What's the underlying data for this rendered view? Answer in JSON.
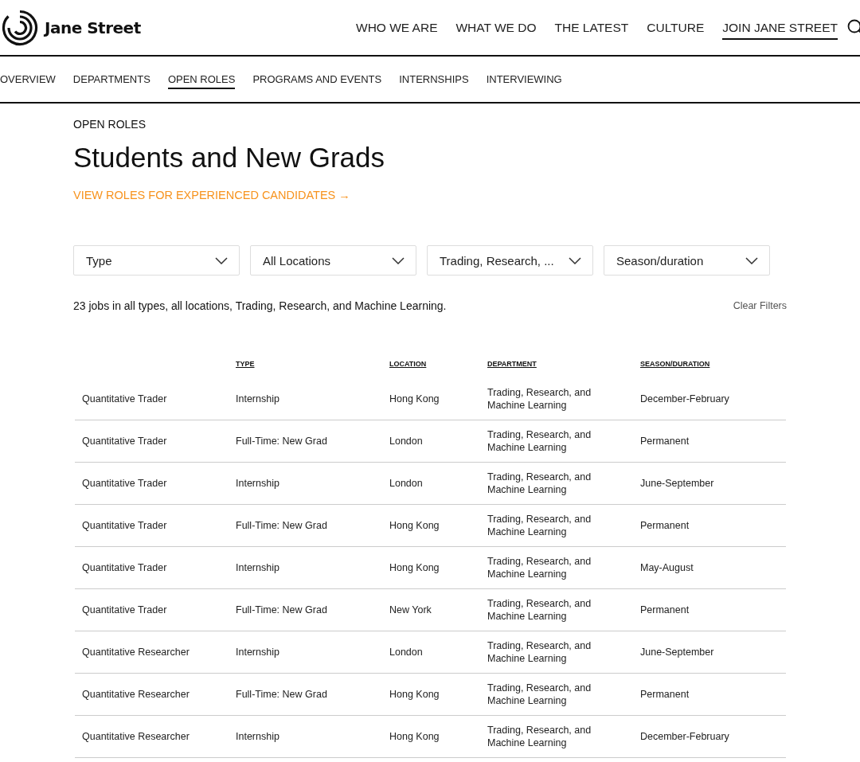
{
  "brand": {
    "name": "Jane Street"
  },
  "main_nav": [
    {
      "label": "WHO WE ARE",
      "selected": false
    },
    {
      "label": "WHAT WE DO",
      "selected": false
    },
    {
      "label": "THE LATEST",
      "selected": false
    },
    {
      "label": "CULTURE",
      "selected": false
    },
    {
      "label": "JOIN JANE STREET",
      "selected": true
    }
  ],
  "sub_nav": [
    {
      "label": "OVERVIEW",
      "selected": false
    },
    {
      "label": "DEPARTMENTS",
      "selected": false
    },
    {
      "label": "OPEN ROLES",
      "selected": true
    },
    {
      "label": "PROGRAMS AND EVENTS",
      "selected": false
    },
    {
      "label": "INTERNSHIPS",
      "selected": false
    },
    {
      "label": "INTERVIEWING",
      "selected": false
    }
  ],
  "eyebrow": "OPEN ROLES",
  "heading": "Students and New Grads",
  "experienced_link": "VIEW ROLES FOR EXPERIENCED CANDIDATES →",
  "filters": [
    "Type",
    "All Locations",
    "Trading, Research, ...",
    "Season/duration"
  ],
  "summary": "23 jobs in all types, all locations, Trading, Research, and Machine Learning.",
  "clear_filters": "Clear Filters",
  "table": {
    "columns": [
      "",
      "TYPE",
      "LOCATION",
      "DEPARTMENT",
      "SEASON/DURATION"
    ],
    "rows": [
      [
        "Quantitative Trader",
        "Internship",
        "Hong Kong",
        "Trading, Research, and Machine Learning",
        "December-February"
      ],
      [
        "Quantitative Trader",
        "Full-Time: New Grad",
        "London",
        "Trading, Research, and Machine Learning",
        "Permanent"
      ],
      [
        "Quantitative Trader",
        "Internship",
        "London",
        "Trading, Research, and Machine Learning",
        "June-September"
      ],
      [
        "Quantitative Trader",
        "Full-Time: New Grad",
        "Hong Kong",
        "Trading, Research, and Machine Learning",
        "Permanent"
      ],
      [
        "Quantitative Trader",
        "Internship",
        "Hong Kong",
        "Trading, Research, and Machine Learning",
        "May-August"
      ],
      [
        "Quantitative Trader",
        "Full-Time: New Grad",
        "New York",
        "Trading, Research, and Machine Learning",
        "Permanent"
      ],
      [
        "Quantitative Researcher",
        "Internship",
        "London",
        "Trading, Research, and Machine Learning",
        "June-September"
      ],
      [
        "Quantitative Researcher",
        "Full-Time: New Grad",
        "Hong Kong",
        "Trading, Research, and Machine Learning",
        "Permanent"
      ],
      [
        "Quantitative Researcher",
        "Internship",
        "Hong Kong",
        "Trading, Research, and Machine Learning",
        "December-February"
      ]
    ]
  }
}
